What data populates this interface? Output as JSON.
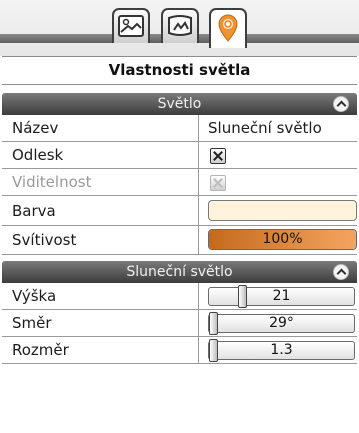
{
  "panel": {
    "title": "Vlastnosti světla"
  },
  "tabs": [
    {
      "icon": "scene-image-icon"
    },
    {
      "icon": "material-image-icon"
    },
    {
      "icon": "light-pin-icon",
      "active": true
    }
  ],
  "light_section": {
    "title": "Světlo",
    "name_label": "Název",
    "name_value": "Sluneční světlo",
    "reflection_label": "Odlesk",
    "reflection_checked": true,
    "visibility_label": "Viditelnost",
    "visibility_checked": true,
    "visibility_disabled": true,
    "color_label": "Barva",
    "color_value": "#fff3dc",
    "intensity_label": "Svítivost",
    "intensity_value": "100%",
    "intensity_fraction": 1.0
  },
  "sun_section": {
    "title": "Sluneční světlo",
    "height_label": "Výška",
    "height_value": "21",
    "height_fraction": 0.21,
    "direction_label": "Směr",
    "direction_value": "29°",
    "direction_fraction": 0.0,
    "size_label": "Rozměr",
    "size_value": "1.3",
    "size_fraction": 0.0
  },
  "colors": {
    "accent": "#f0922e",
    "header_dark": "#3c3c3c"
  }
}
